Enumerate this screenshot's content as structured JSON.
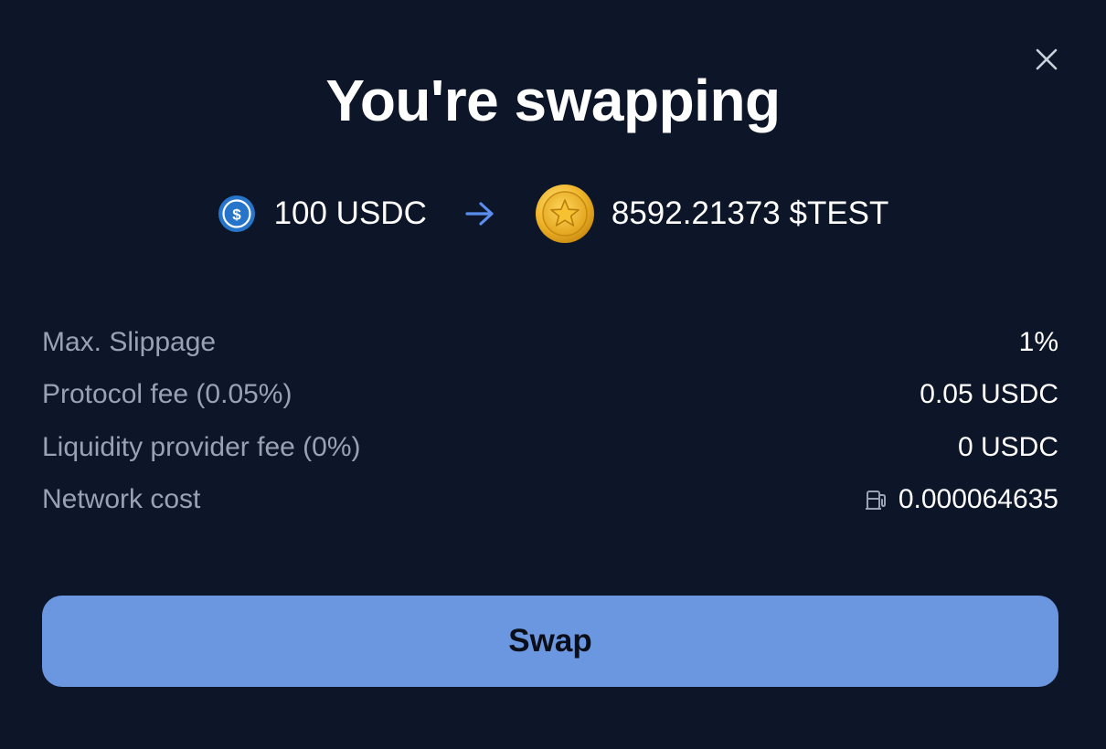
{
  "title": "You're swapping",
  "swap": {
    "from": {
      "amount_label": "100 USDC",
      "icon": "usdc-icon"
    },
    "to": {
      "amount_label": "8592.21373 $TEST",
      "icon": "test-token-icon"
    }
  },
  "details": [
    {
      "label": "Max. Slippage",
      "value": "1%"
    },
    {
      "label": "Protocol fee (0.05%)",
      "value": "0.05 USDC"
    },
    {
      "label": "Liquidity provider fee (0%)",
      "value": "0 USDC"
    },
    {
      "label": "Network cost",
      "value": "0.000064635",
      "icon": "gas-pump-icon"
    }
  ],
  "button": {
    "label": "Swap"
  },
  "colors": {
    "background": "#0d1628",
    "accent": "#6b96e0",
    "muted_text": "#98a2b3",
    "usdc_blue": "#2775ca",
    "arrow_blue": "#5b8def"
  }
}
